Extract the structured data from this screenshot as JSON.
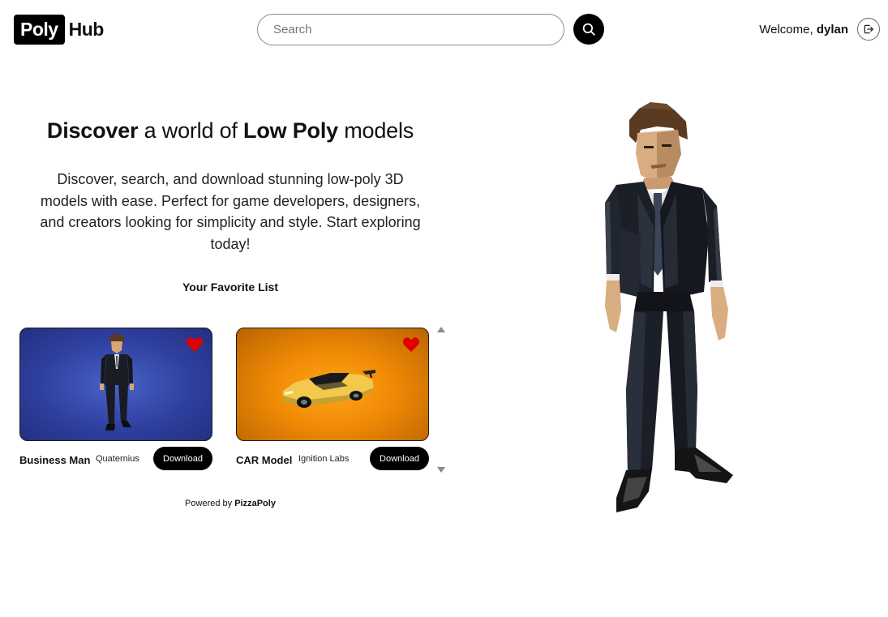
{
  "app": {
    "logo_box": "Poly",
    "logo_text": "Hub"
  },
  "header": {
    "search_placeholder": "Search",
    "welcome_prefix": "Welcome,",
    "username": "dylan",
    "icons": [
      "search-icon",
      "logout-icon"
    ]
  },
  "hero": {
    "title_part1": "Discover",
    "title_part2": " a world of ",
    "title_part3": "Low Poly",
    "title_part4": " models",
    "description": "Discover, search, and download stunning low-poly 3D models with ease. Perfect for game developers, designers, and creators looking for simplicity and style. Start exploring today!"
  },
  "favorites": {
    "title": "Your Favorite List",
    "items": [
      {
        "name": "Business Man",
        "author": "Quaternius",
        "button": "Download",
        "thumb_color": "#2f40a0"
      },
      {
        "name": "CAR Model",
        "author": "Ignition Labs",
        "button": "Download",
        "thumb_color": "#f08a06"
      }
    ]
  },
  "footer": {
    "powered_prefix": "Powered by ",
    "powered_brand": "PizzaPoly"
  },
  "colors": {
    "accent": "#000000",
    "heart": "#e00000",
    "background": "#ffffff"
  }
}
